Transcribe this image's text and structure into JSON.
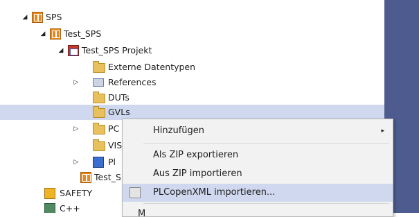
{
  "tree": {
    "items": [
      {
        "label": "SPS",
        "icon": "plc-icon"
      },
      {
        "label": "Test_SPS",
        "icon": "plc-icon"
      },
      {
        "label": "Test_SPS Projekt",
        "icon": "project-icon"
      },
      {
        "label": "Externe Datentypen",
        "icon": "folder-icon"
      },
      {
        "label": "References",
        "icon": "references-icon"
      },
      {
        "label": "DUTs",
        "icon": "folder-icon"
      },
      {
        "label": "GVLs",
        "icon": "folder-icon"
      },
      {
        "label": "PC",
        "icon": "folder-icon"
      },
      {
        "label": "VIS",
        "icon": "folder-icon"
      },
      {
        "label": "Pl",
        "icon": "pou-icon"
      },
      {
        "label": "Test_S",
        "icon": "plc-icon"
      },
      {
        "label": "SAFETY",
        "icon": "safety-icon"
      },
      {
        "label": "C++",
        "icon": "cpp-icon"
      }
    ]
  },
  "context_menu": {
    "items": [
      {
        "label": "Hinzufügen",
        "submenu_glyph": "▸"
      },
      {
        "label": "Als ZIP exportieren"
      },
      {
        "label": "Aus ZIP importieren"
      },
      {
        "label": "PLCopenXML importieren..."
      }
    ],
    "partial_label": "M"
  }
}
